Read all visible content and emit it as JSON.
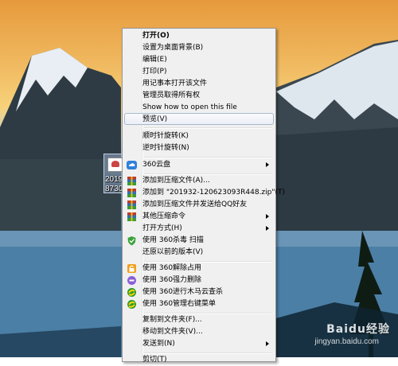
{
  "desktop": {
    "icon_label_line1": "2019",
    "icon_label_line2": "8730",
    "watermark": "Baidu经验",
    "watermark_sub": "jingyan.baidu.com"
  },
  "menu": {
    "open": "打开(O)",
    "set_bg": "设置为桌面背景(B)",
    "edit": "编辑(E)",
    "print": "打印(P)",
    "notepad": "用记事本打开该文件",
    "admin": "管理员取得所有权",
    "show_how": "Show how to open this file",
    "preview": "预览(V)",
    "rotate_cw": "顺时针旋转(K)",
    "rotate_ccw": "逆时针旋转(N)",
    "cloud360": "360云盘",
    "add_archive": "添加到压缩文件(A)...",
    "add_zip": "添加到 \"201932-120623093R448.zip\"(T)",
    "add_send_qq": "添加到压缩文件并发送给QQ好友",
    "other_compress": "其他压缩命令",
    "open_with": "打开方式(H)",
    "scan360": "使用 360杀毒 扫描",
    "restore": "还原以前的版本(V)",
    "unlock360": "使用 360解除占用",
    "force_delete": "使用 360强力删除",
    "trojan_scan": "使用 360进行木马云查杀",
    "manage_menu": "使用 360管理右键菜单",
    "copy_to": "复制到文件夹(F)...",
    "move_to": "移动到文件夹(V)...",
    "send_to": "发送到(N)",
    "cut": "剪切(T)"
  }
}
